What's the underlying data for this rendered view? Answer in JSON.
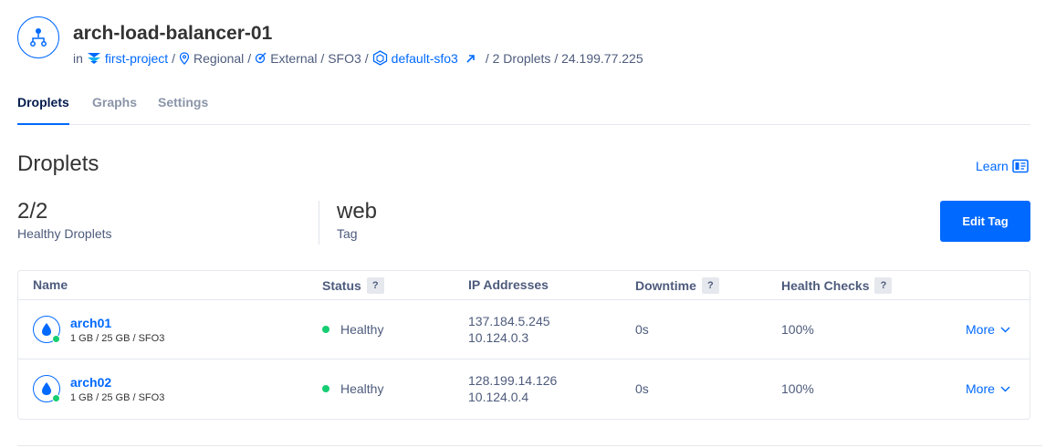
{
  "header": {
    "title": "arch-load-balancer-01",
    "in_label": "in",
    "project": "first-project",
    "separator": "/",
    "region_type": "Regional",
    "visibility_location": "External / SFO3",
    "vpc": "default-sfo3",
    "tail": "/ 2 Droplets / 24.199.77.225",
    "icons": [
      "load-balancer-icon",
      "project-icon",
      "location-pin-icon",
      "external-target-icon",
      "vpc-icon",
      "external-link-arrow-icon"
    ]
  },
  "tabs": [
    {
      "label": "Droplets",
      "active": true
    },
    {
      "label": "Graphs",
      "active": false
    },
    {
      "label": "Settings",
      "active": false
    }
  ],
  "section": {
    "title": "Droplets",
    "learn_label": "Learn",
    "learn_icon": "book-icon"
  },
  "stats": {
    "healthy_value": "2/2",
    "healthy_label": "Healthy Droplets",
    "tag_value": "web",
    "tag_label": "Tag"
  },
  "edit_tag_label": "Edit Tag",
  "table": {
    "headers": {
      "name": "Name",
      "status": "Status",
      "ip": "IP Addresses",
      "downtime": "Downtime",
      "health": "Health Checks",
      "help": "?"
    },
    "rows": [
      {
        "name": "arch01",
        "spec": "1 GB / 25 GB / SFO3",
        "status": "Healthy",
        "ip_public": "137.184.5.245",
        "ip_private": "10.124.0.3",
        "downtime": "0s",
        "health": "100%",
        "more": "More"
      },
      {
        "name": "arch02",
        "spec": "1 GB / 25 GB / SFO3",
        "status": "Healthy",
        "ip_public": "128.199.14.126",
        "ip_private": "10.124.0.4",
        "downtime": "0s",
        "health": "100%",
        "more": "More"
      }
    ]
  },
  "colors": {
    "accent": "#0069ff",
    "healthy": "#15cd72"
  }
}
